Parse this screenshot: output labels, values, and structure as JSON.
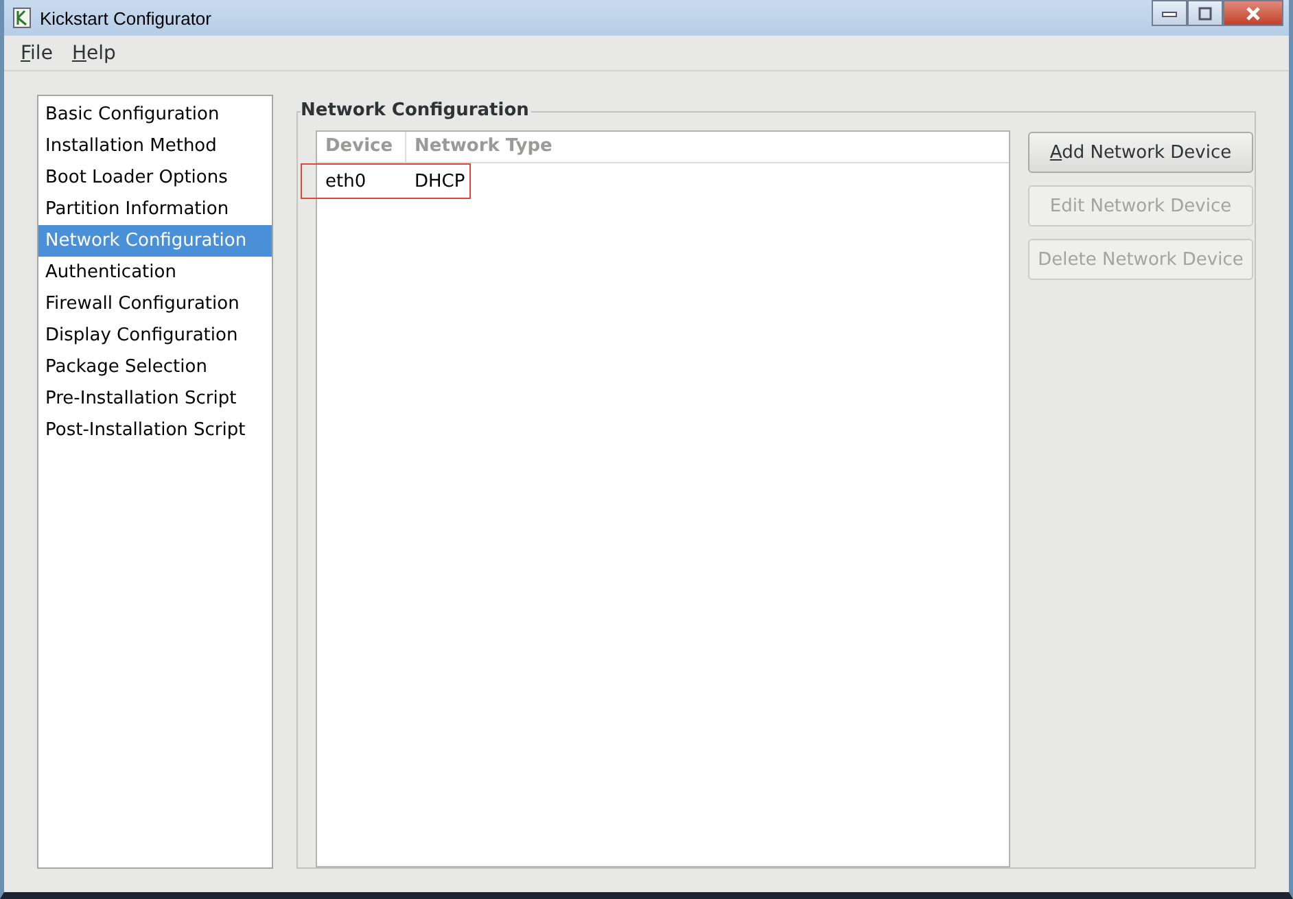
{
  "window": {
    "title": "Kickstart Configurator"
  },
  "menu": [
    {
      "label": "File",
      "mnemonic": true
    },
    {
      "label": "Help",
      "mnemonic": true
    }
  ],
  "sidebar": {
    "items": [
      {
        "label": "Basic Configuration",
        "selected": false
      },
      {
        "label": "Installation Method",
        "selected": false
      },
      {
        "label": "Boot Loader Options",
        "selected": false
      },
      {
        "label": "Partition Information",
        "selected": false
      },
      {
        "label": "Network Configuration",
        "selected": true
      },
      {
        "label": "Authentication",
        "selected": false
      },
      {
        "label": "Firewall Configuration",
        "selected": false
      },
      {
        "label": "Display Configuration",
        "selected": false
      },
      {
        "label": "Package Selection",
        "selected": false
      },
      {
        "label": "Pre-Installation Script",
        "selected": false
      },
      {
        "label": "Post-Installation Script",
        "selected": false
      }
    ]
  },
  "section": {
    "title": "Network Configuration"
  },
  "table": {
    "columns": [
      "Device",
      "Network Type"
    ],
    "rows": [
      {
        "cells": [
          "eth0",
          "DHCP"
        ],
        "highlighted": true
      }
    ]
  },
  "buttons": [
    {
      "label": "Add Network Device",
      "disabled": false,
      "mnemonic": true
    },
    {
      "label": "Edit Network Device",
      "disabled": true,
      "mnemonic": false
    },
    {
      "label": "Delete Network Device",
      "disabled": true,
      "mnemonic": false
    }
  ]
}
